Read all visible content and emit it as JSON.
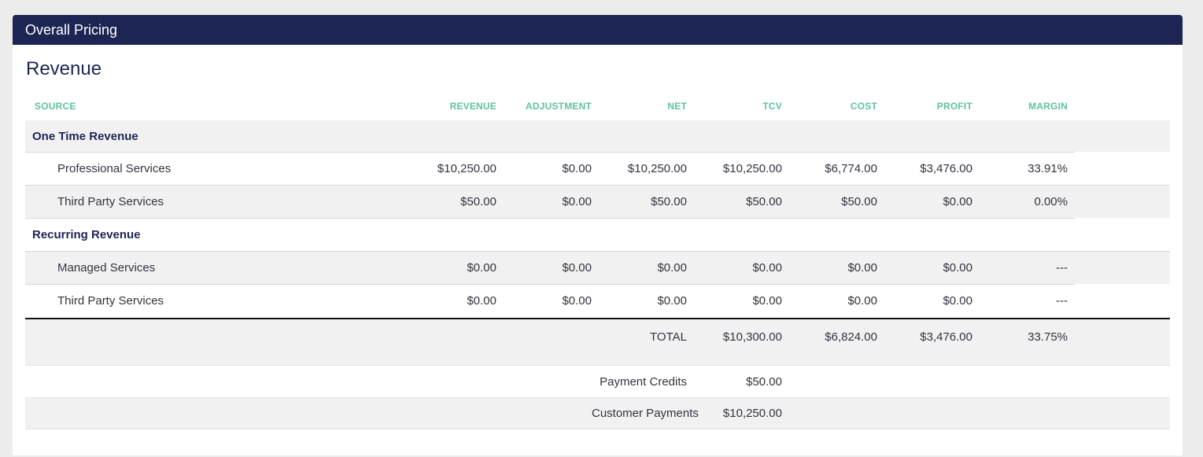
{
  "panel": {
    "title": "Overall Pricing"
  },
  "section": {
    "title": "Revenue"
  },
  "columns": {
    "source": "SOURCE",
    "revenue": "REVENUE",
    "adjustment": "ADJUSTMENT",
    "net": "NET",
    "tcv": "TCV",
    "cost": "COST",
    "profit": "PROFIT",
    "margin": "MARGIN"
  },
  "groups": [
    {
      "label": "One Time Revenue",
      "rows": [
        {
          "source": "Professional Services",
          "revenue": "$10,250.00",
          "adjustment": "$0.00",
          "net": "$10,250.00",
          "tcv": "$10,250.00",
          "cost": "$6,774.00",
          "profit": "$3,476.00",
          "margin": "33.91%"
        },
        {
          "source": "Third Party Services",
          "revenue": "$50.00",
          "adjustment": "$0.00",
          "net": "$50.00",
          "tcv": "$50.00",
          "cost": "$50.00",
          "profit": "$0.00",
          "margin": "0.00%"
        }
      ]
    },
    {
      "label": "Recurring Revenue",
      "rows": [
        {
          "source": "Managed Services",
          "revenue": "$0.00",
          "adjustment": "$0.00",
          "net": "$0.00",
          "tcv": "$0.00",
          "cost": "$0.00",
          "profit": "$0.00",
          "margin": "---"
        },
        {
          "source": "Third Party Services",
          "revenue": "$0.00",
          "adjustment": "$0.00",
          "net": "$0.00",
          "tcv": "$0.00",
          "cost": "$0.00",
          "profit": "$0.00",
          "margin": "---"
        }
      ]
    }
  ],
  "total": {
    "label": "TOTAL",
    "tcv": "$10,300.00",
    "cost": "$6,824.00",
    "profit": "$3,476.00",
    "margin": "33.75%"
  },
  "payment_credits": {
    "label": "Payment Credits",
    "value": "$50.00"
  },
  "customer_payments": {
    "label": "Customer Payments",
    "value": "$10,250.00"
  }
}
